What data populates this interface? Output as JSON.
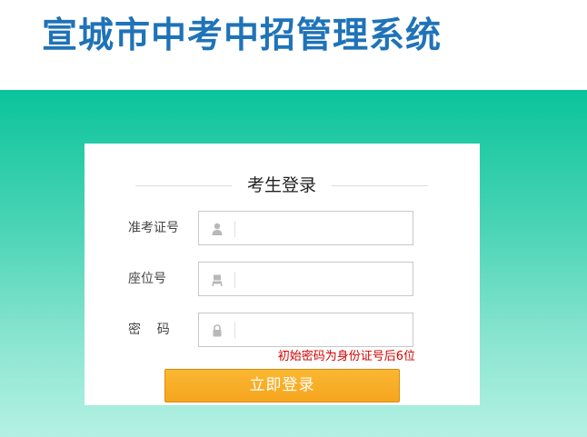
{
  "header": {
    "title": "宣城市中考中招管理系统"
  },
  "login": {
    "title": "考生登录",
    "fields": [
      {
        "label": "准考证号",
        "icon": "user-icon",
        "value": "",
        "placeholder": ""
      },
      {
        "label": "座位号",
        "icon": "seat-icon",
        "value": "",
        "placeholder": ""
      },
      {
        "label": "密    码",
        "icon": "lock-icon",
        "value": "",
        "placeholder": ""
      }
    ],
    "hint": "初始密码为身份证号后6位",
    "submit_label": "立即登录"
  },
  "colors": {
    "title_blue": "#1f73b8",
    "band_top": "#0bc49b",
    "band_bottom": "#b4f1e4",
    "button_orange": "#f7a823",
    "hint_red": "#d40000"
  }
}
